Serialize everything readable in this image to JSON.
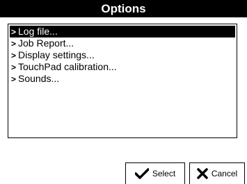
{
  "window": {
    "title": "Options"
  },
  "menu": {
    "items": [
      {
        "label": "Log file...",
        "selected": true
      },
      {
        "label": "Job Report...",
        "selected": false
      },
      {
        "label": "Display settings...",
        "selected": false
      },
      {
        "label": "TouchPad calibration...",
        "selected": false
      },
      {
        "label": "Sounds...",
        "selected": false
      }
    ],
    "bullet": ">"
  },
  "buttons": {
    "select_label": "Select",
    "select_icon": "checkmark-icon",
    "cancel_label": "Cancel",
    "cancel_icon": "x-icon"
  },
  "colors": {
    "title_bg": "#000000",
    "title_fg": "#ffffff",
    "selection_bg": "#000000",
    "selection_fg": "#ffffff"
  }
}
